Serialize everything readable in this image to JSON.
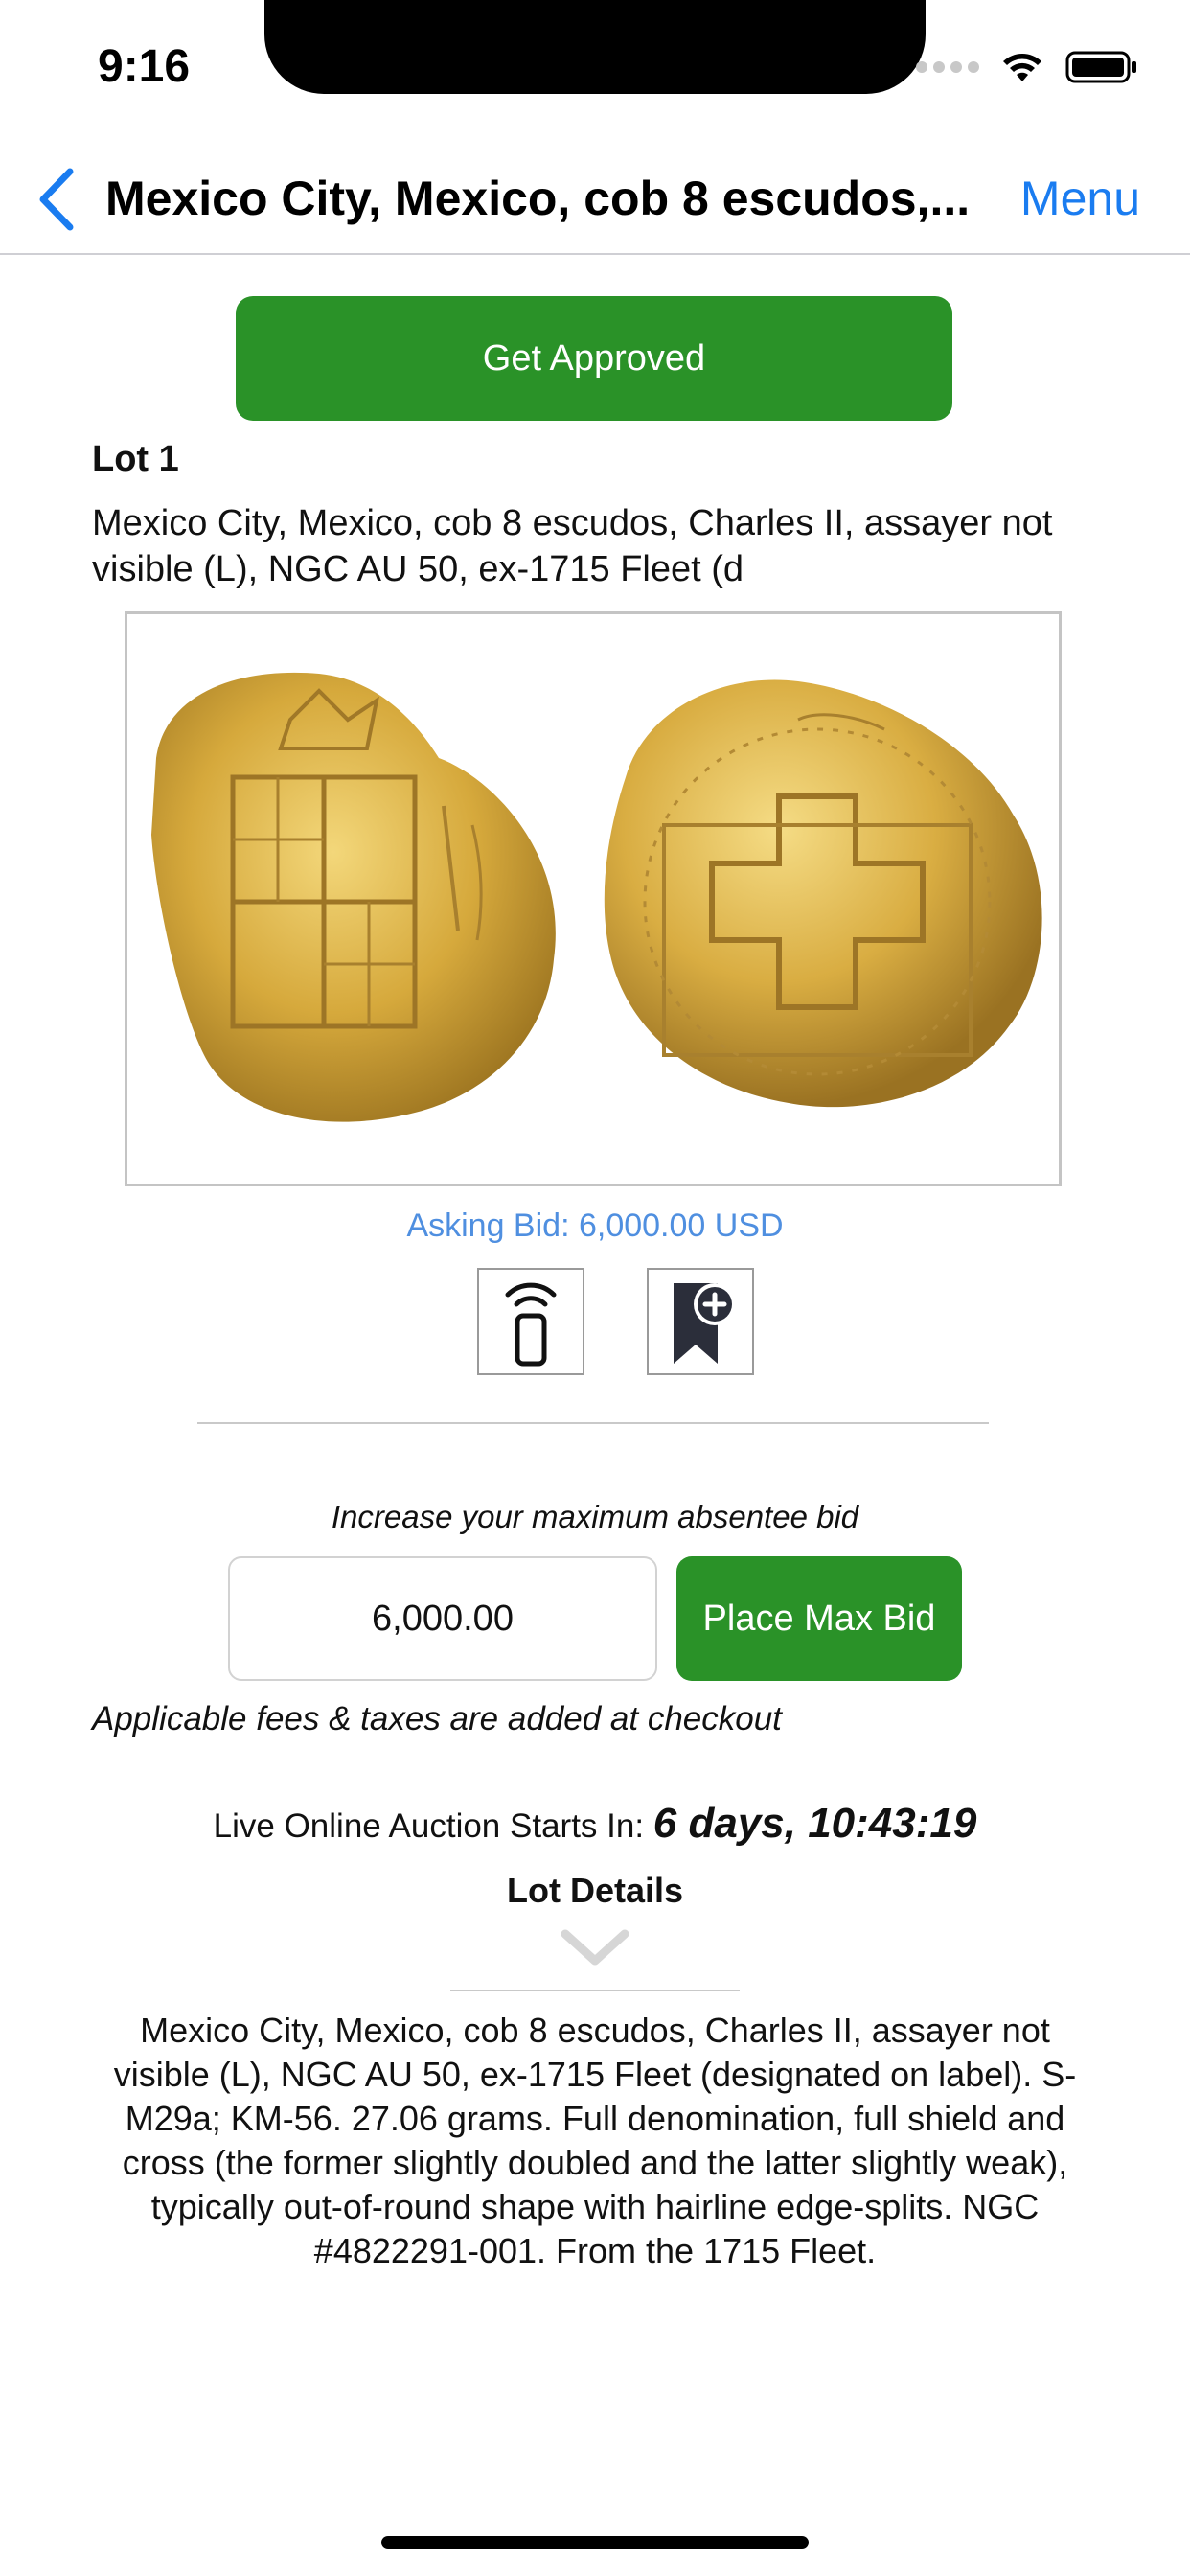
{
  "status_bar": {
    "time": "9:16"
  },
  "nav": {
    "back_icon": "chevron-left-icon",
    "title": "Mexico City, Mexico, cob 8 escudos,...",
    "menu_label": "Menu"
  },
  "approve_button": {
    "label": "Get Approved"
  },
  "lot": {
    "label": "Lot 1",
    "title": "Mexico City, Mexico, cob 8 escudos, Charles II, assayer not visible (L), NGC AU 50, ex-1715 Fleet (d",
    "asking_bid": "Asking Bid: 6,000.00 USD"
  },
  "actions": {
    "remote_bid_icon": "phone-signal-icon",
    "watchlist_icon": "bookmark-add-icon"
  },
  "bid": {
    "increase_label": "Increase your maximum absentee bid",
    "amount_value": "6,000.00",
    "place_label": "Place Max Bid",
    "fees_note": "Applicable fees & taxes are added at checkout"
  },
  "auction": {
    "starts_label": "Live Online Auction Starts In: ",
    "time_left": "6 days, 10:43:19"
  },
  "details": {
    "label": "Lot Details",
    "description": "Mexico City, Mexico, cob 8 escudos, Charles II, assayer not visible (L), NGC AU 50, ex-1715 Fleet (designated on label). S-M29a; KM-56. 27.06 grams. Full denomination, full shield and cross (the former slightly doubled and the latter slightly weak), typically out-of-round shape with hairline edge-splits. NGC #4822291-001. From the 1715 Fleet."
  },
  "colors": {
    "accent_green": "#2a9228",
    "link_blue": "#1a7cf0",
    "asking_blue": "#4f8fe0"
  }
}
